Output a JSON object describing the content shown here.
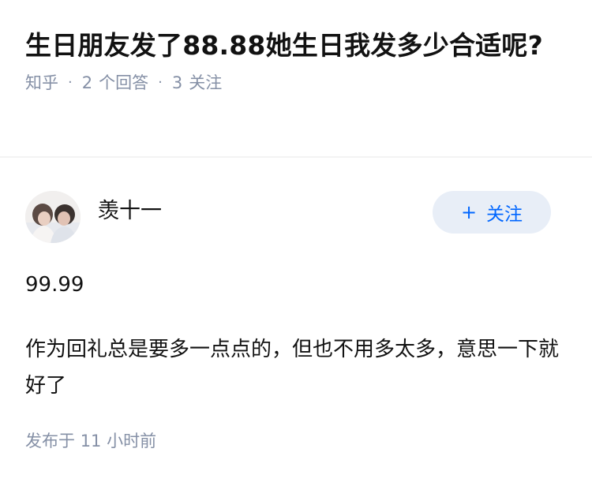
{
  "question": {
    "title": "生日朋友发了88.88她生日我发多少合适呢?",
    "source": "知乎",
    "answer_count": "2",
    "answer_label": "个回答",
    "follow_count": "3",
    "follow_label": "关注",
    "separator": "·"
  },
  "answer": {
    "author_name": "羡十一",
    "follow_button": {
      "icon": "plus-icon",
      "label": "关注"
    },
    "paragraphs": [
      "99.99",
      "作为回礼总是要多一点点的，但也不用多太多，意思一下就好了"
    ],
    "time_prefix": "发布于",
    "time_value": "11 小时前"
  },
  "colors": {
    "title": "#121212",
    "meta": "#8590a6",
    "follow_bg": "#e8eef7",
    "follow_text": "#0066ff",
    "divider": "#f3f3f3"
  }
}
